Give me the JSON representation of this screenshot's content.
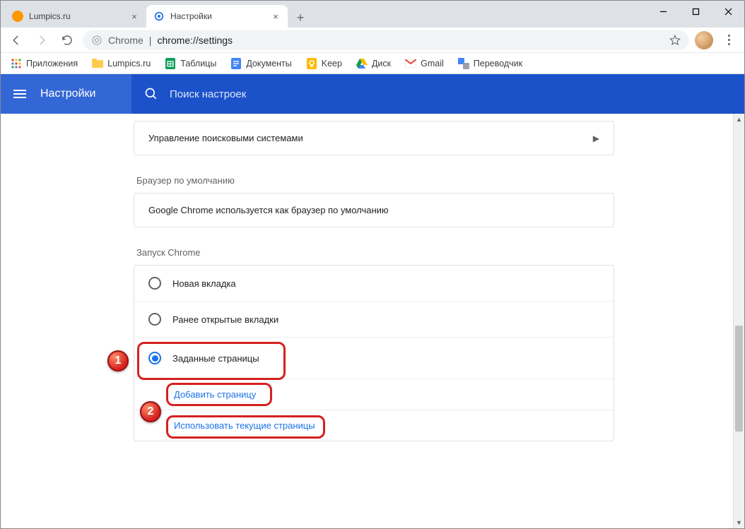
{
  "window": {
    "tabs": [
      {
        "title": "Lumpics.ru",
        "active": false
      },
      {
        "title": "Настройки",
        "active": true
      }
    ]
  },
  "omnibox": {
    "scheme_label": "Chrome",
    "url": "chrome://settings"
  },
  "bookmarks": [
    {
      "label": "Приложения"
    },
    {
      "label": "Lumpics.ru"
    },
    {
      "label": "Таблицы"
    },
    {
      "label": "Документы"
    },
    {
      "label": "Keep"
    },
    {
      "label": "Диск"
    },
    {
      "label": "Gmail"
    },
    {
      "label": "Переводчик"
    }
  ],
  "settings_header": {
    "title": "Настройки",
    "search_placeholder": "Поиск настроек"
  },
  "sections": {
    "search_engines_row": "Управление поисковыми системами",
    "default_browser_title": "Браузер по умолчанию",
    "default_browser_text": "Google Chrome используется как браузер по умолчанию",
    "startup_title": "Запуск Chrome",
    "startup_options": [
      {
        "label": "Новая вкладка",
        "checked": false
      },
      {
        "label": "Ранее открытые вкладки",
        "checked": false
      },
      {
        "label": "Заданные страницы",
        "checked": true
      }
    ],
    "add_page": "Добавить страницу",
    "use_current": "Использовать текущие страницы"
  },
  "annotations": {
    "badge1": "1",
    "badge2": "2"
  }
}
